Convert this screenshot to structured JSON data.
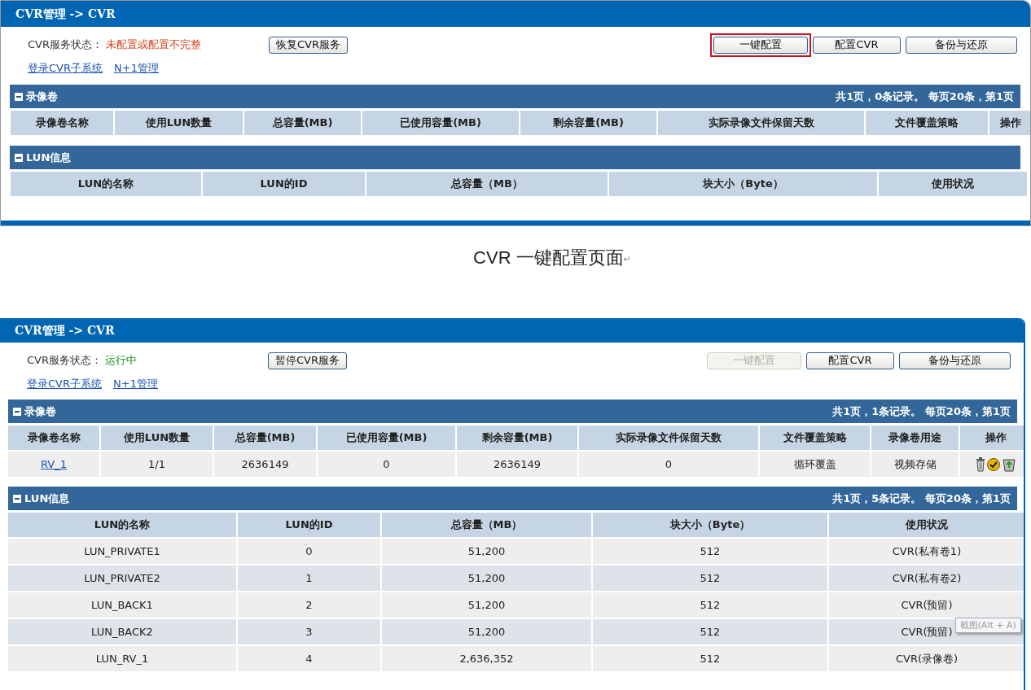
{
  "panels": [
    {
      "title": "CVR管理 -> CVR",
      "status_label": "CVR服务状态：",
      "status": {
        "text": "未配置或配置不完整",
        "kind": "error"
      },
      "service_button": "恢复CVR服务",
      "buttons": [
        {
          "label": "一键配置",
          "disabled": false,
          "highlighted": true
        },
        {
          "label": "配置CVR",
          "disabled": false,
          "highlighted": false
        },
        {
          "label": "备份与还原",
          "disabled": false,
          "highlighted": false
        }
      ],
      "links": [
        "登录CVR子系统",
        "N+1管理"
      ],
      "volumes": {
        "title": "录像卷",
        "expanded": true,
        "pagination": "共1页，0条记录。 每页20条，第1页",
        "columns": [
          "录像卷名称",
          "使用LUN数量",
          "总容量(MB)",
          "已使用容量(MB)",
          "剩余容量(MB)",
          "实际录像文件保留天数",
          "文件覆盖策略",
          "操作"
        ]
      },
      "luns": {
        "title": "LUN信息",
        "expanded": true,
        "columns": [
          "LUN的名称",
          "LUN的ID",
          "总容量（MB）",
          "块大小（Byte）",
          "使用状况"
        ]
      }
    },
    {
      "title": "CVR管理 -> CVR",
      "status_label": "CVR服务状态：",
      "status": {
        "text": "运行中",
        "kind": "running"
      },
      "service_button": "暂停CVR服务",
      "buttons": [
        {
          "label": "一键配置",
          "disabled": true,
          "highlighted": false
        },
        {
          "label": "配置CVR",
          "disabled": false,
          "highlighted": false
        },
        {
          "label": "备份与还原",
          "disabled": false,
          "highlighted": false
        }
      ],
      "links": [
        "登录CVR子系统",
        "N+1管理"
      ],
      "volumes": {
        "title": "录像卷",
        "expanded": true,
        "pagination": "共1页，1条记录。 每页20条，第1页",
        "columns": [
          "录像卷名称",
          "使用LUN数量",
          "总容量(MB)",
          "已使用容量(MB)",
          "剩余容量(MB)",
          "实际录像文件保留天数",
          "文件覆盖策略",
          "录像卷用途",
          "操作"
        ],
        "rows": [
          {
            "cells": [
              "RV_1",
              "1/1",
              "2636149",
              "0",
              "2636149",
              "0",
              "循环覆盖",
              "视频存储"
            ],
            "actions": [
              {
                "kind": "delete"
              },
              {
                "kind": "check"
              },
              {
                "kind": "recycle"
              }
            ]
          }
        ]
      },
      "luns": {
        "title": "LUN信息",
        "expanded": true,
        "pagination": "共1页，5条记录。 每页20条，第1页",
        "columns": [
          "LUN的名称",
          "LUN的ID",
          "总容量（MB）",
          "块大小（Byte）",
          "使用状况"
        ],
        "rows": [
          {
            "cells": [
              "LUN_PRIVATE1",
              "0",
              "51,200",
              "512",
              "CVR(私有卷1)"
            ]
          },
          {
            "cells": [
              "LUN_PRIVATE2",
              "1",
              "51,200",
              "512",
              "CVR(私有卷2)"
            ]
          },
          {
            "cells": [
              "LUN_BACK1",
              "2",
              "51,200",
              "512",
              "CVR(预留)"
            ]
          },
          {
            "cells": [
              "LUN_BACK2",
              "3",
              "51,200",
              "512",
              "CVR(预留)"
            ],
            "tooltip": "截图(Alt + A)"
          },
          {
            "cells": [
              "LUN_RV_1",
              "4",
              "2,636,352",
              "512",
              "CVR(录像卷)"
            ]
          }
        ]
      }
    }
  ],
  "caption": {
    "text": "CVR 一键配置页面",
    "paragraph_mark": "↵"
  }
}
